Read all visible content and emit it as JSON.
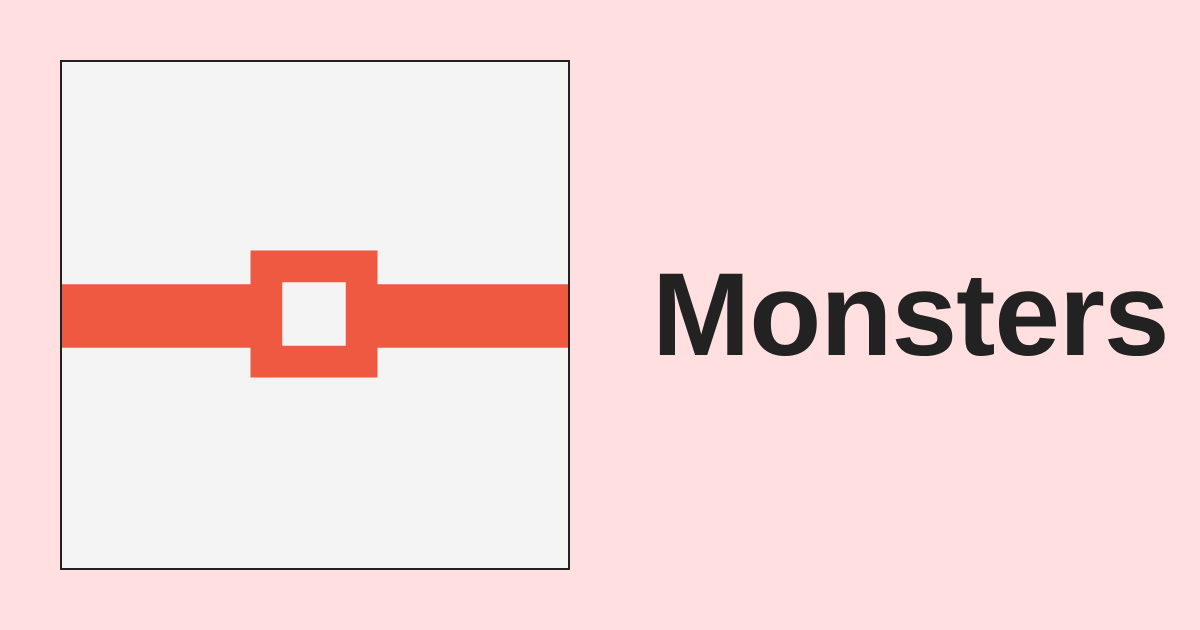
{
  "title": "Monsters",
  "logo": {
    "icon": "belt-buckle-icon",
    "band_color": "#F05941",
    "background_color": "#F4F4F4",
    "border_color": "#222222"
  },
  "colors": {
    "page_background": "#FFDFE0",
    "title_text": "#222222"
  }
}
